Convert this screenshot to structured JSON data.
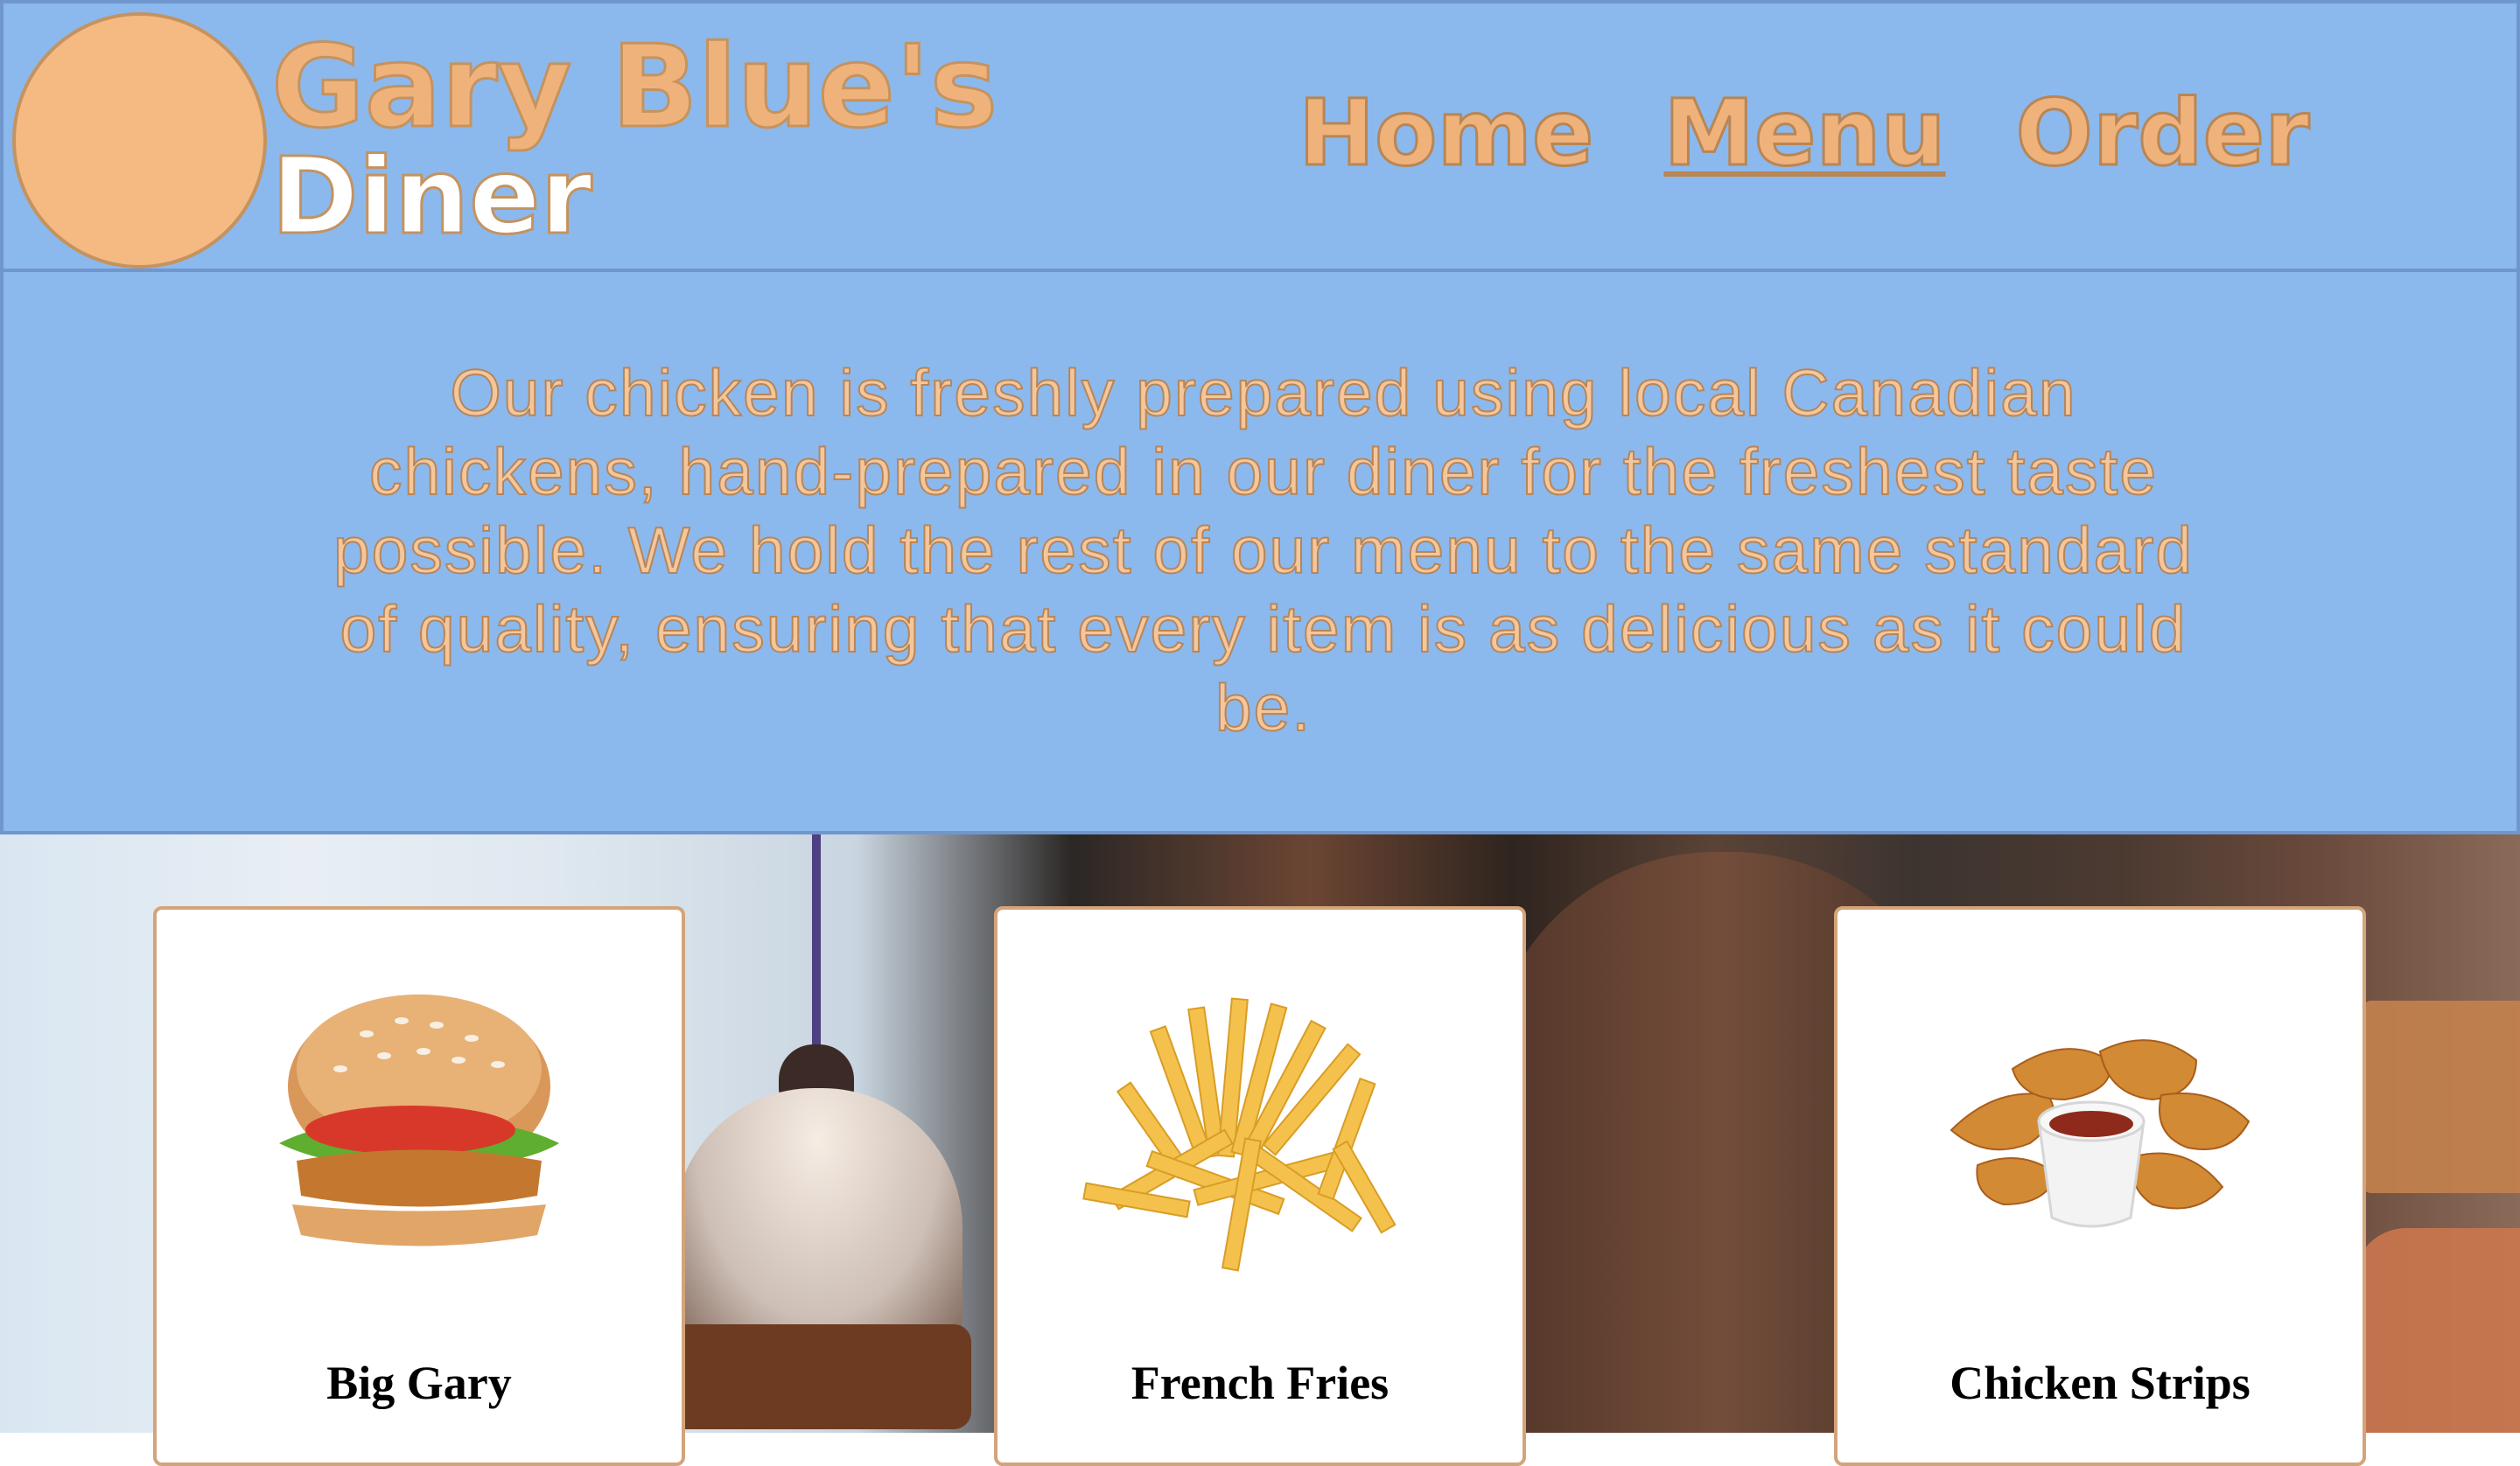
{
  "header": {
    "brand_line1": "Gary Blue's",
    "brand_line2": "Diner",
    "nav": [
      {
        "label": "Home",
        "active": false
      },
      {
        "label": "Menu",
        "active": true
      },
      {
        "label": "Order",
        "active": false
      }
    ]
  },
  "intro": {
    "text": "Our chicken is freshly prepared using local Canadian chickens, hand-prepared in our diner for the freshest taste possible. We hold the rest of our menu to the same standard of quality, ensuring that every item is as delicious as it could be."
  },
  "menu_items": [
    {
      "title": "Big Gary",
      "icon": "burger-image"
    },
    {
      "title": "French Fries",
      "icon": "fries-image"
    },
    {
      "title": "Chicken Strips",
      "icon": "chicken-strips-image"
    }
  ],
  "colors": {
    "header_bg": "#8bb9ee",
    "accent_orange": "#f0b27b",
    "card_border": "#d3a47b"
  }
}
